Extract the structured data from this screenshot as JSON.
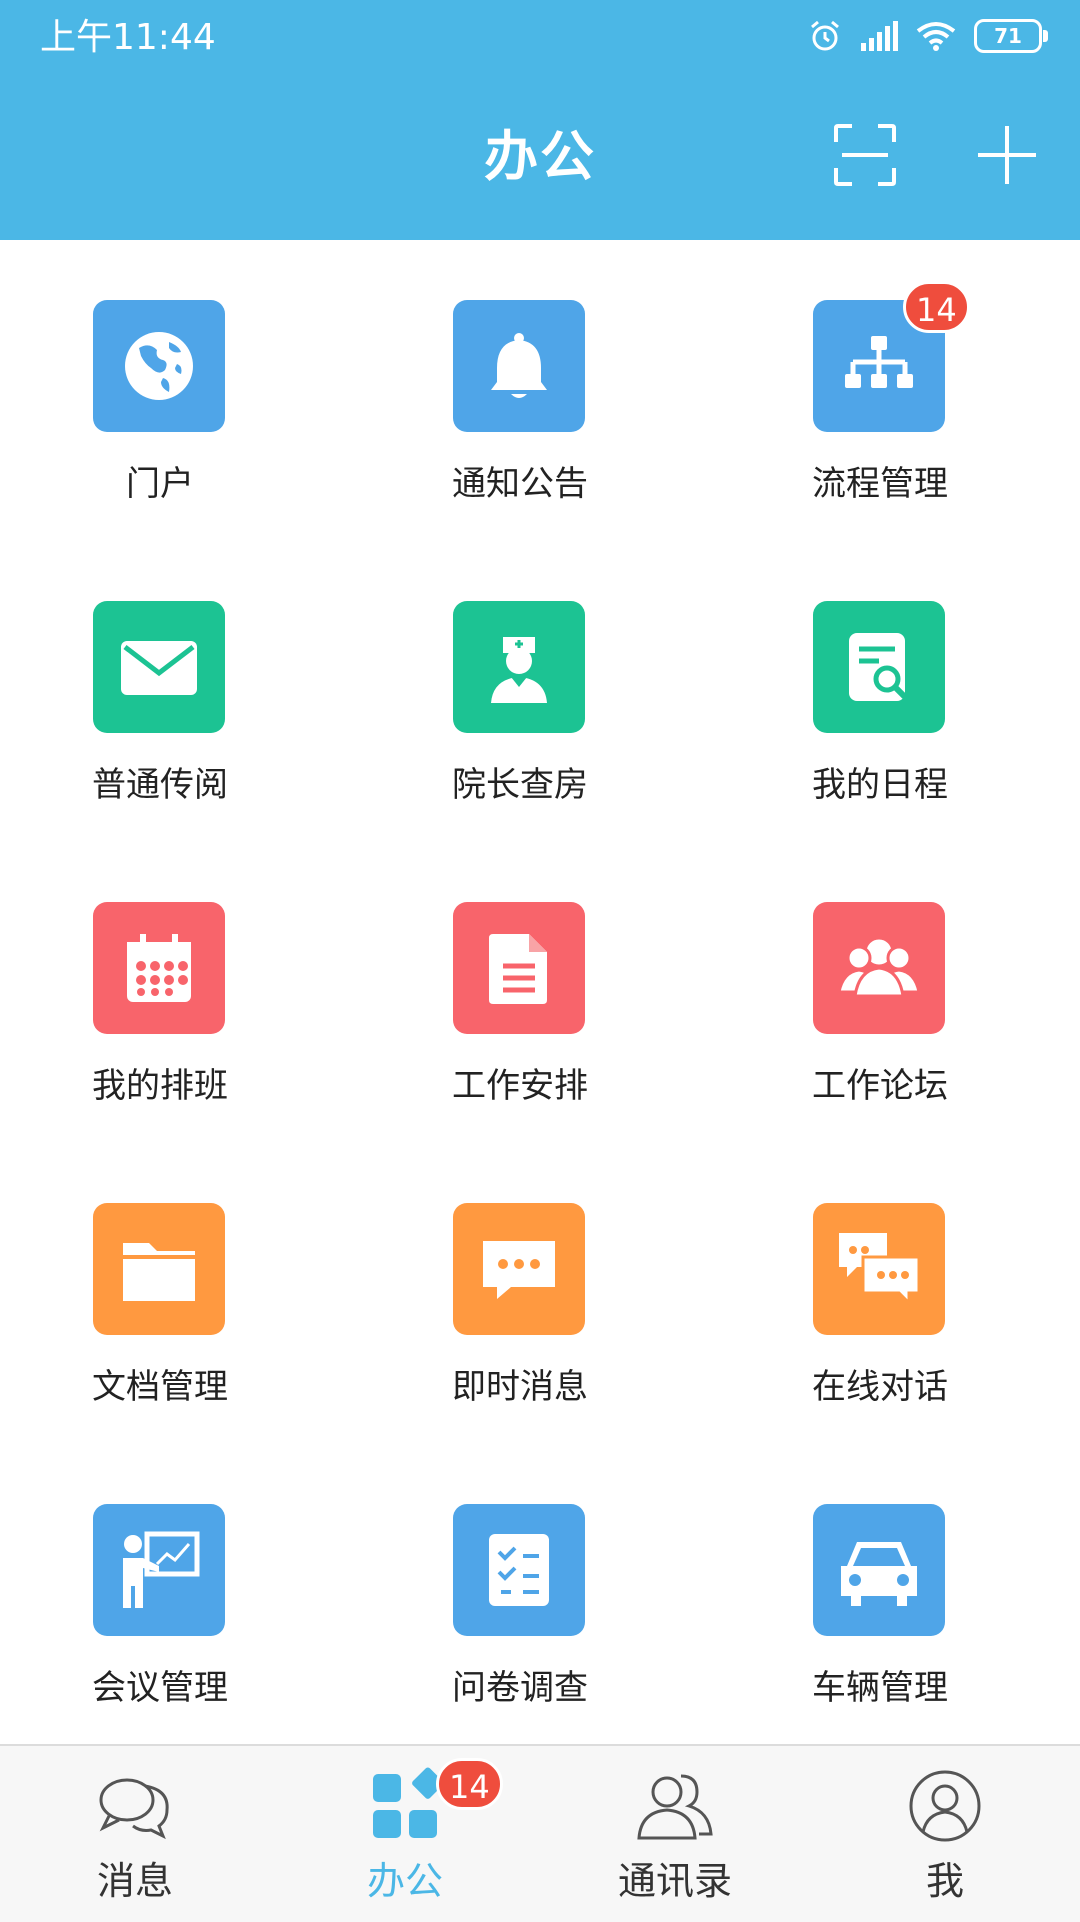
{
  "status_bar": {
    "time": "上午11:44",
    "battery": "71"
  },
  "header": {
    "title": "办公"
  },
  "colors": {
    "header": "#4bb7e6",
    "blue": "#4fa5e8",
    "green": "#1cc393",
    "red": "#f8646b",
    "orange": "#ff9940",
    "badge": "#ef4d3d"
  },
  "apps": [
    {
      "label": "门户",
      "icon": "globe-icon"
    },
    {
      "label": "通知公告",
      "icon": "bell-icon"
    },
    {
      "label": "流程管理",
      "icon": "org-chart-icon",
      "badge": "14"
    },
    {
      "label": "普通传阅",
      "icon": "mail-icon"
    },
    {
      "label": "院长查房",
      "icon": "doctor-icon"
    },
    {
      "label": "我的日程",
      "icon": "document-search-icon"
    },
    {
      "label": "我的排班",
      "icon": "calendar-icon"
    },
    {
      "label": "工作安排",
      "icon": "document-icon"
    },
    {
      "label": "工作论坛",
      "icon": "group-icon"
    },
    {
      "label": "文档管理",
      "icon": "folder-icon"
    },
    {
      "label": "即时消息",
      "icon": "chat-bubble-icon"
    },
    {
      "label": "在线对话",
      "icon": "conversation-icon"
    },
    {
      "label": "会议管理",
      "icon": "presentation-icon"
    },
    {
      "label": "问卷调查",
      "icon": "checklist-icon"
    },
    {
      "label": "车辆管理",
      "icon": "car-icon"
    }
  ],
  "tabs": [
    {
      "label": "消息",
      "icon": "chat-icon"
    },
    {
      "label": "办公",
      "icon": "apps-icon",
      "badge": "14",
      "active": true
    },
    {
      "label": "通讯录",
      "icon": "contacts-icon"
    },
    {
      "label": "我",
      "icon": "profile-icon"
    }
  ]
}
